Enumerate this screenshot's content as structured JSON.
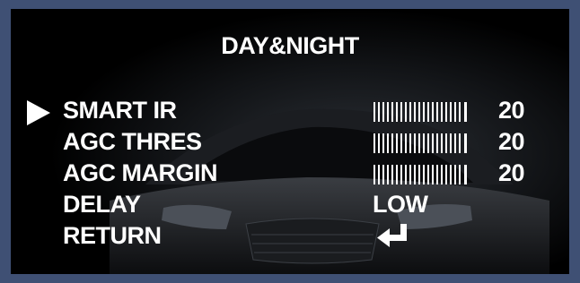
{
  "osd": {
    "title": "DAY&NIGHT",
    "cursor_icon": "right-triangle-cursor-icon",
    "items": [
      {
        "label": "SMART IR",
        "value": "20",
        "level": 20,
        "selected": true
      },
      {
        "label": "AGC THRES",
        "value": "20",
        "level": 20
      },
      {
        "label": "AGC MARGIN",
        "value": "20",
        "level": 20
      },
      {
        "label": "DELAY",
        "value": "LOW"
      },
      {
        "label": "RETURN",
        "icon": "enter-arrow-icon"
      }
    ]
  },
  "colors": {
    "border": "#3f5074",
    "screen": "#000000",
    "text": "#ffffff"
  }
}
